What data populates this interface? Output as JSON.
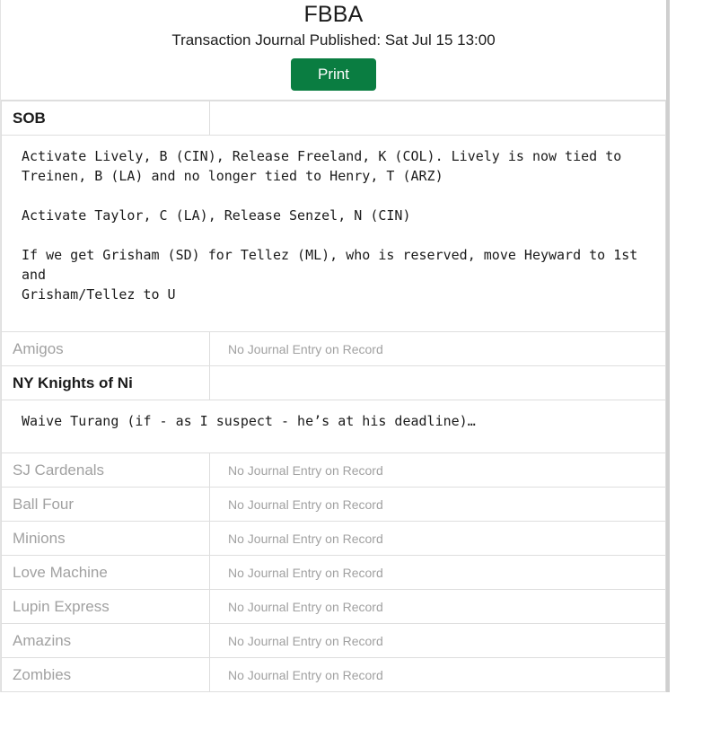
{
  "header": {
    "app_title": "FBBA",
    "published_label": "Transaction Journal Published: Sat Jul 15 13:00",
    "print_label": "Print"
  },
  "colors": {
    "print_button_green": "#0a7d41",
    "muted_gray": "#a1a1a1",
    "border_gray": "#dedede",
    "text_black": "#1b1b1b"
  },
  "labels": {
    "no_entry": "No Journal Entry on Record"
  },
  "teams": [
    {
      "name": "SOB",
      "has_entry": true,
      "entry": "Activate Lively, B (CIN), Release Freeland, K (COL). Lively is now tied to\nTreinen, B (LA) and no longer tied to Henry, T (ARZ)\n\nActivate Taylor, C (LA), Release Senzel, N (CIN)\n\nIf we get Grisham (SD) for Tellez (ML), who is reserved, move Heyward to 1st and\nGrisham/Tellez to U"
    },
    {
      "name": "Amigos",
      "has_entry": false,
      "entry": "No Journal Entry on Record"
    },
    {
      "name": "NY Knights of Ni",
      "has_entry": true,
      "entry": "Waive Turang (if - as I suspect - he’s at his deadline)…"
    },
    {
      "name": "SJ Cardenals",
      "has_entry": false,
      "entry": "No Journal Entry on Record"
    },
    {
      "name": "Ball Four",
      "has_entry": false,
      "entry": "No Journal Entry on Record"
    },
    {
      "name": "Minions",
      "has_entry": false,
      "entry": "No Journal Entry on Record"
    },
    {
      "name": "Love Machine",
      "has_entry": false,
      "entry": "No Journal Entry on Record"
    },
    {
      "name": "Lupin Express",
      "has_entry": false,
      "entry": "No Journal Entry on Record"
    },
    {
      "name": "Amazins",
      "has_entry": false,
      "entry": "No Journal Entry on Record"
    },
    {
      "name": "Zombies",
      "has_entry": false,
      "entry": "No Journal Entry on Record"
    }
  ]
}
